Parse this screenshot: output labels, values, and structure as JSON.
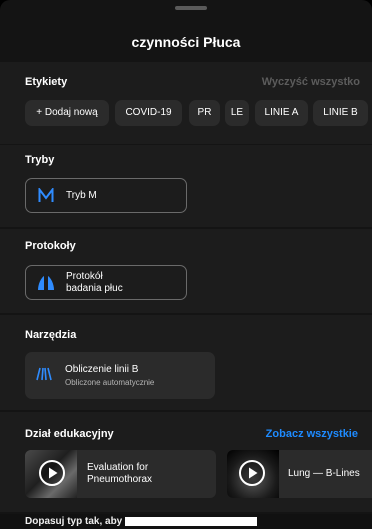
{
  "sheet": {
    "title": "czynności Płuca"
  },
  "labels": {
    "heading": "Etykiety",
    "clear_all": "Wyczyść wszystko",
    "chips": [
      "+ Dodaj nową",
      "COVID-19",
      "PR",
      "LE",
      "LINIE A",
      "LINIE B"
    ]
  },
  "modes": {
    "heading": "Tryby",
    "item_label": "Tryb M",
    "item_icon": "letter-m-icon"
  },
  "protocols": {
    "heading": "Protokoły",
    "item_line1": "Protokół",
    "item_line2": "badania płuc",
    "item_icon": "lungs-icon"
  },
  "tools": {
    "heading": "Narzędzia",
    "item_title": "Obliczenie linii B",
    "item_subtitle": "Obliczone automatycznie",
    "item_icon": "b-lines-icon"
  },
  "education": {
    "heading": "Dział edukacyjny",
    "see_all": "Zobacz wszystkie",
    "items": [
      {
        "line1": "Evaluation for",
        "line2": "Pneumothorax",
        "icon": "play-icon"
      },
      {
        "line1": "Lung — B-Lines",
        "icon": "play-icon"
      }
    ]
  },
  "bottom": {
    "text": "Dopasuj typ tak, aby"
  },
  "colors": {
    "accent": "#1e8bff",
    "icon_blue": "#2f8cff",
    "muted": "#5c5c5c",
    "background": "#141414",
    "section": "#1c1c1c",
    "chip": "#2b2b2b"
  }
}
